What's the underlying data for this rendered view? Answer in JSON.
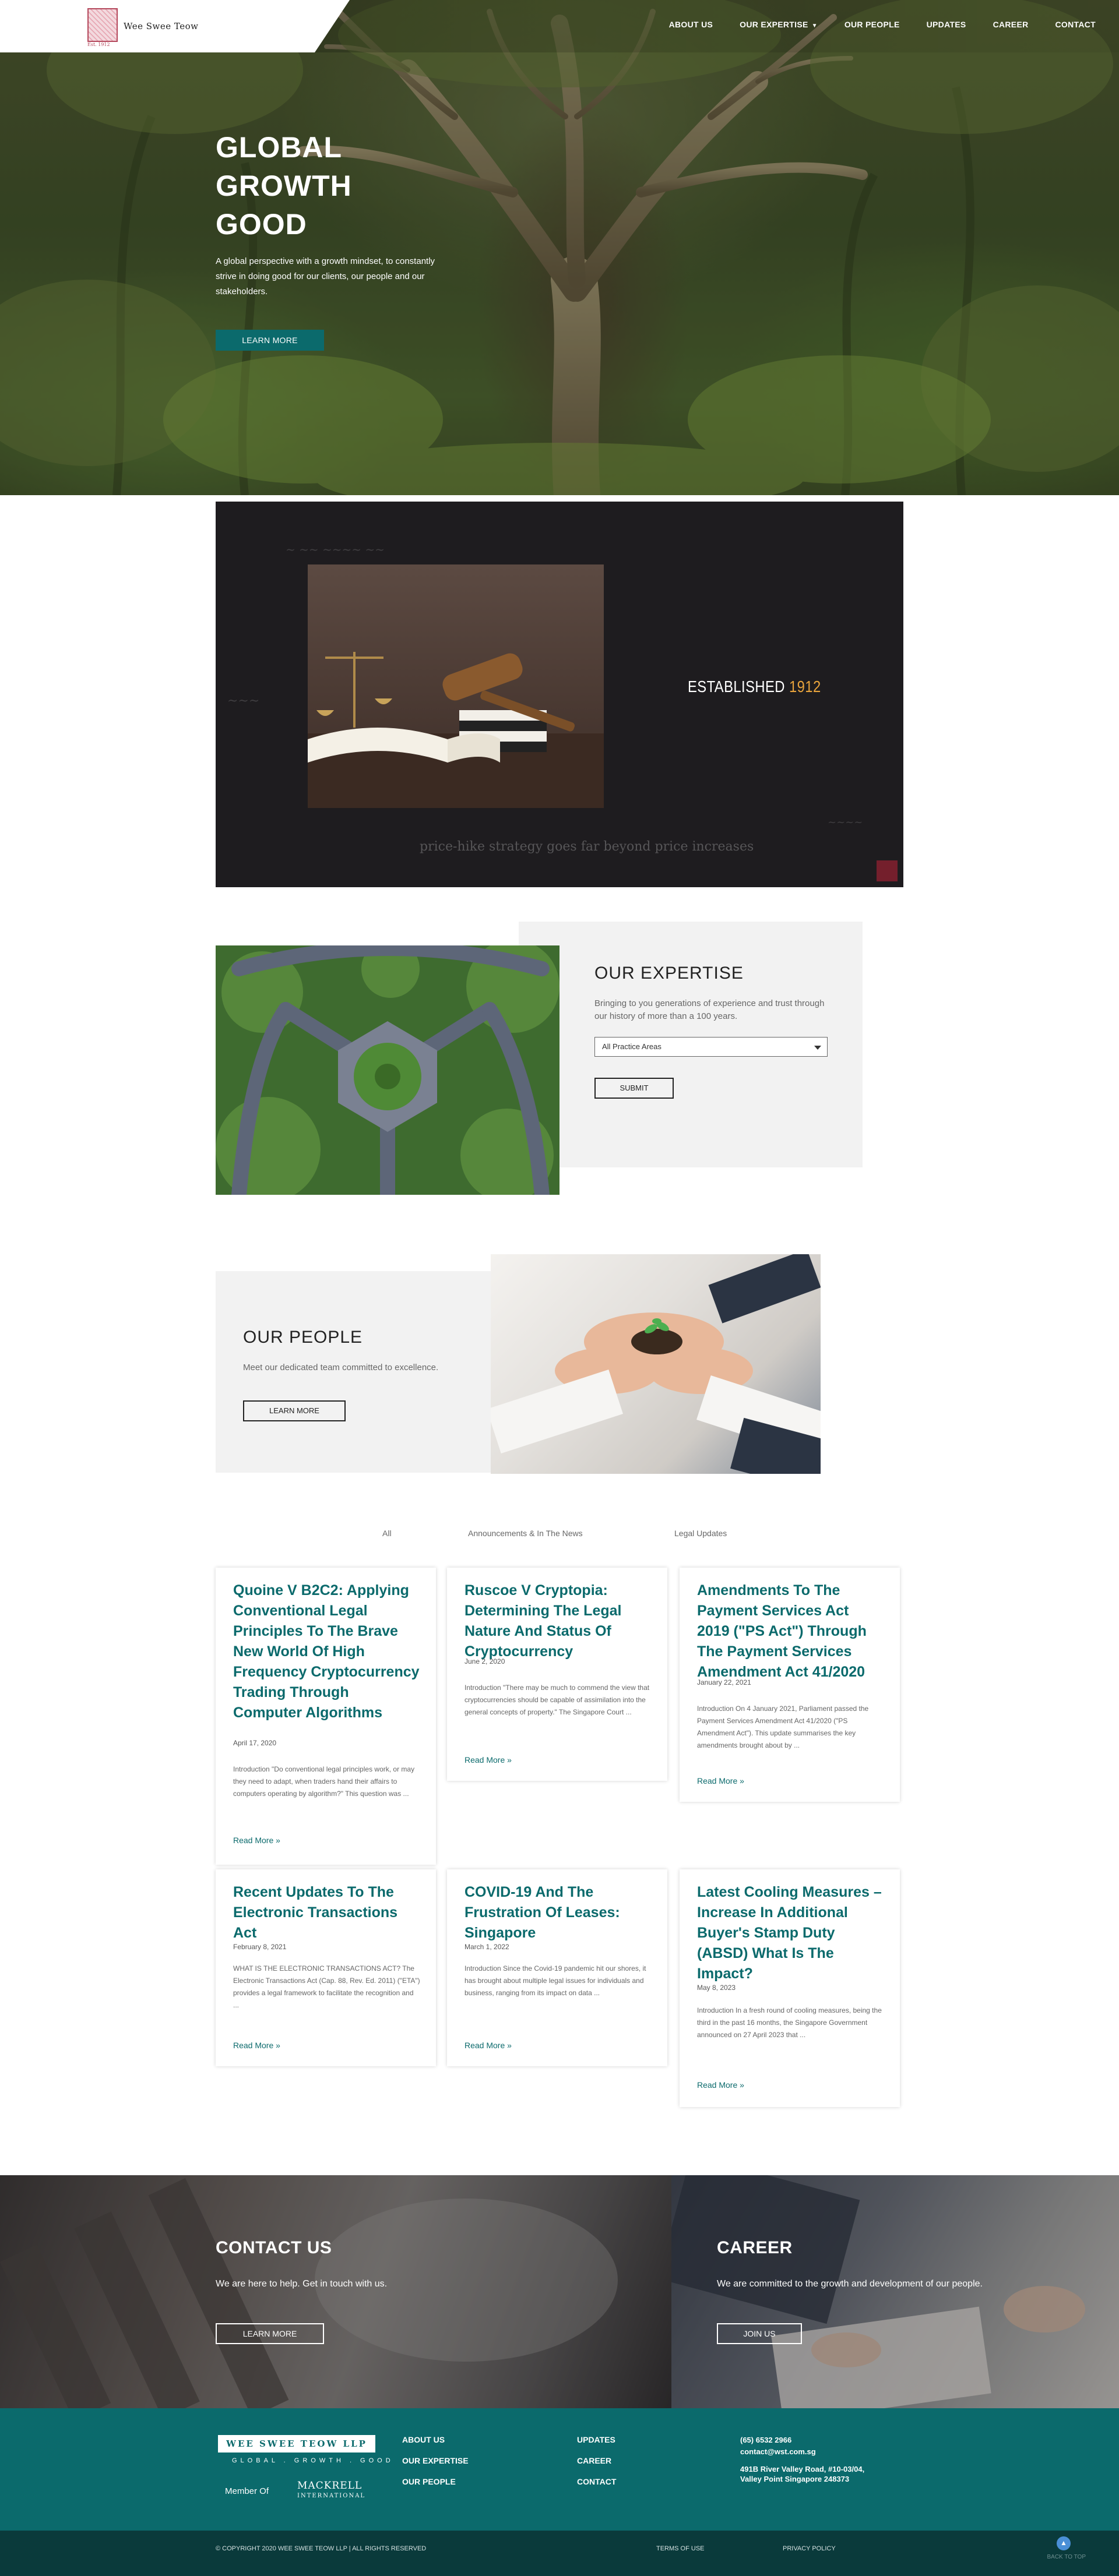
{
  "header": {
    "logo_text": "Wee Swee Teow",
    "logo_mark_caption": "Est. 1912",
    "nav": [
      {
        "label": "ABOUT US"
      },
      {
        "label": "OUR EXPERTISE"
      },
      {
        "label": "OUR PEOPLE"
      },
      {
        "label": "UPDATES"
      },
      {
        "label": "CAREER"
      },
      {
        "label": "CONTACT"
      }
    ]
  },
  "hero": {
    "title_lines": [
      "GLOBAL",
      "GROWTH",
      "GOOD"
    ],
    "subtitle": "A global perspective with a growth mindset, to constantly strive in doing good for our clients, our people and our stakeholders.",
    "button": "LEARN MORE"
  },
  "video": {
    "established_label": "ESTABLISHED",
    "established_year": "1912",
    "chalk_text": "price-hike strategy goes far beyond price increases"
  },
  "expertise": {
    "title": "OUR EXPERTISE",
    "description": "Bringing to you generations of experience and trust through our history of more than a 100 years.",
    "select_value": "All Practice Areas",
    "submit": "SUBMIT"
  },
  "people": {
    "title": "OUR PEOPLE",
    "description": "Meet our dedicated team committed to excellence.",
    "button": "LEARN MORE"
  },
  "news": {
    "filters": [
      "All",
      "Announcements & In The News",
      "Legal Updates"
    ],
    "cards": [
      {
        "title": "Quoine V B2C2: Applying Conventional Legal Principles To The Brave New World Of High Frequency Cryptocurrency Trading Through Computer Algorithms",
        "date": "April 17, 2020",
        "excerpt": "Introduction \"Do conventional legal principles work, or may they need to adapt, when traders hand their affairs to computers operating by algorithm?\" This question was ...",
        "more": "Read More »"
      },
      {
        "title": "Ruscoe V Cryptopia: Determining The Legal Nature And Status Of Cryptocurrency",
        "date": "June 2, 2020",
        "excerpt": "Introduction \"There may be much to commend the view that cryptocurrencies should be capable of assimilation into the general concepts of property.\" The Singapore Court ...",
        "more": "Read More »"
      },
      {
        "title": "Amendments To The Payment Services Act 2019 (\"PS Act\") Through The Payment Services Amendment Act 41/2020",
        "date": "January 22, 2021",
        "excerpt": "Introduction On 4 January 2021, Parliament passed the Payment Services Amendment Act 41/2020 (\"PS Amendment Act\"). This update summarises the key amendments brought about by ...",
        "more": "Read More »"
      },
      {
        "title": "Recent Updates To The Electronic Transactions Act",
        "date": "February 8, 2021",
        "excerpt": "WHAT IS THE ELECTRONIC TRANSACTIONS ACT? The Electronic Transactions Act (Cap. 88, Rev. Ed. 2011) (\"ETA\") provides a legal framework to facilitate the recognition and ...",
        "more": "Read More »"
      },
      {
        "title": "COVID-19 And The Frustration Of Leases: Singapore",
        "date": "March 1, 2022",
        "excerpt": "Introduction Since the Covid-19 pandemic hit our shores, it has brought about multiple legal issues for individuals and business, ranging from its impact on data ...",
        "more": "Read More »"
      },
      {
        "title": "Latest Cooling Measures – Increase In Additional Buyer's Stamp Duty (ABSD) What Is The Impact?",
        "date": "May 8, 2023",
        "excerpt": "Introduction In a fresh round of cooling measures, being the third in the past 16 months, the Singapore Government announced on 27 April 2023 that ...",
        "more": "Read More »"
      }
    ]
  },
  "cta": {
    "contact_title": "CONTACT US",
    "contact_sub": "We are here to help. Get in touch with us.",
    "contact_button": "LEARN MORE",
    "career_title": "CAREER",
    "career_sub": "We are committed to the growth and development of our people.",
    "career_button": "JOIN US"
  },
  "footer": {
    "logo": "WEE SWEE TEOW LLP",
    "tagline": "GLOBAL . GROWTH . GOOD",
    "member_of": "Member Of",
    "mackrell": "MACKRELL",
    "mackrell_sub": "INTERNATIONAL",
    "col1": [
      "ABOUT US",
      "OUR EXPERTISE",
      "OUR PEOPLE"
    ],
    "col2": [
      "UPDATES",
      "CAREER",
      "CONTACT"
    ],
    "phone": "(65) 6532 2966",
    "email": "contact@wst.com.sg",
    "address_1": "491B River Valley Road, #10-03/04,",
    "address_2": "Valley Point Singapore 248373",
    "copyright": "© COPYRIGHT 2020 WEE SWEE TEOW LLP | ALL RIGHTS RESERVED",
    "terms": "TERMS OF USE",
    "privacy": "PRIVACY POLICY",
    "back_to_top": "BACK TO TOP"
  },
  "colors": {
    "brand_teal": "#0b6a6c",
    "accent_gold": "#e8a33c",
    "footer_dark": "#0a3a3b"
  }
}
